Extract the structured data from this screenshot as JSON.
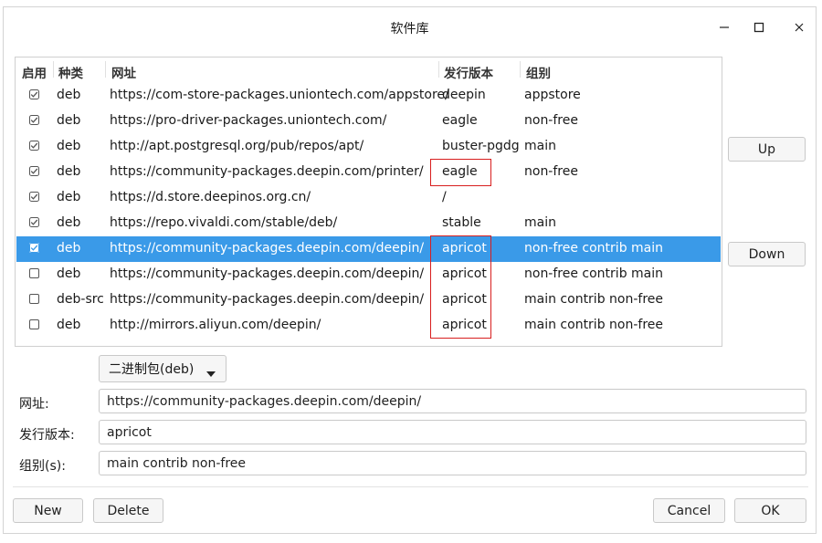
{
  "window": {
    "title": "软件库"
  },
  "table": {
    "headers": {
      "enabled": "启用",
      "type": "种类",
      "url": "网址",
      "distribution": "发行版本",
      "components": "组别"
    },
    "rows": [
      {
        "enabled": true,
        "type": "deb",
        "url": "https://com-store-packages.uniontech.com/appstore/",
        "distribution": "deepin",
        "components": "appstore"
      },
      {
        "enabled": true,
        "type": "deb",
        "url": "https://pro-driver-packages.uniontech.com/",
        "distribution": "eagle",
        "components": "non-free"
      },
      {
        "enabled": true,
        "type": "deb",
        "url": "http://apt.postgresql.org/pub/repos/apt/",
        "distribution": "buster-pgdg",
        "components": "main"
      },
      {
        "enabled": true,
        "type": "deb",
        "url": "https://community-packages.deepin.com/printer/",
        "distribution": "eagle",
        "components": "non-free"
      },
      {
        "enabled": true,
        "type": "deb",
        "url": "https://d.store.deepinos.org.cn/",
        "distribution": "/",
        "components": ""
      },
      {
        "enabled": true,
        "type": "deb",
        "url": "https://repo.vivaldi.com/stable/deb/",
        "distribution": "stable",
        "components": "main"
      },
      {
        "enabled": true,
        "type": "deb",
        "url": "https://community-packages.deepin.com/deepin/",
        "distribution": "apricot",
        "components": "non-free contrib main",
        "selected": true
      },
      {
        "enabled": false,
        "type": "deb",
        "url": "https://community-packages.deepin.com/deepin/",
        "distribution": "apricot",
        "components": "non-free contrib main"
      },
      {
        "enabled": false,
        "type": "deb-src",
        "url": "https://community-packages.deepin.com/deepin/",
        "distribution": "apricot",
        "components": "main contrib non-free"
      },
      {
        "enabled": false,
        "type": "deb",
        "url": "http://mirrors.aliyun.com/deepin/",
        "distribution": "apricot",
        "components": "main contrib non-free"
      }
    ]
  },
  "buttons": {
    "up": "Up",
    "down": "Down",
    "new": "New",
    "delete": "Delete",
    "cancel": "Cancel",
    "ok": "OK"
  },
  "editor": {
    "type_selected": "二进制包(deb)",
    "url_label": "网址:",
    "url_value": "https://community-packages.deepin.com/deepin/",
    "distribution_label": "发行版本:",
    "distribution_value": "apricot",
    "components_label": "组别(s):",
    "components_value": "main contrib non-free"
  },
  "colors": {
    "selection": "#3a9ae8",
    "highlight_box": "#d81e1e"
  }
}
